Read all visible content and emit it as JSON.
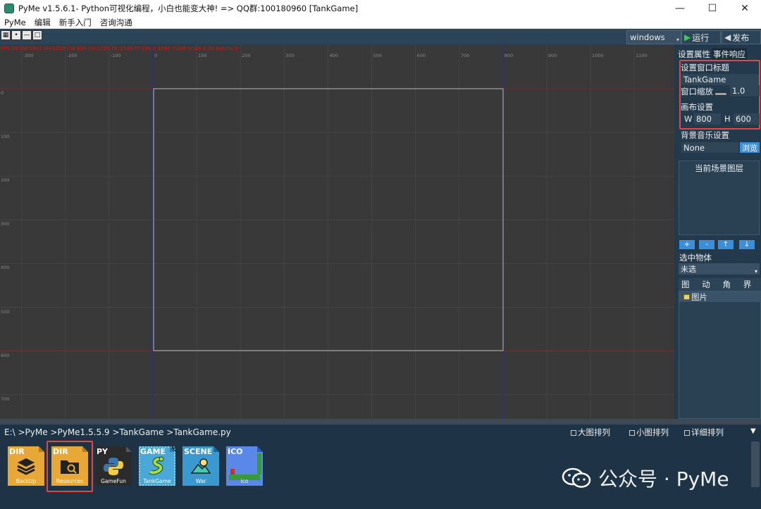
{
  "window": {
    "title": "PyMe v1.5.6.1- Python可视化编程，小白也能变大神!  => QQ群:100180960   [TankGame]",
    "minimize": "—",
    "maximize": "☐",
    "close": "✕"
  },
  "menu": [
    "PyMe",
    "编辑",
    "新手入门",
    "咨询沟通"
  ],
  "toolbar": {
    "icons": [
      "grid-icon",
      "dot-icon",
      "line-icon",
      "square-icon"
    ],
    "platform": "windows",
    "run_label": "运行",
    "publish_label": "发布"
  },
  "stage": {
    "fps_text": "FPS:59 SW:1912 SH:1209 CW:690 CH:1209 PX:1549 PY:339 X:1060 Y:206 Scale:1.10 Batchs:0",
    "ruler_x": [
      "-300",
      "-200",
      "-100",
      "0",
      "100",
      "200",
      "300",
      "400",
      "500",
      "600",
      "700",
      "800",
      "900",
      "1000",
      "1100"
    ],
    "ruler_y": [
      "0",
      "100",
      "200",
      "300",
      "400",
      "500",
      "600",
      "700"
    ]
  },
  "panel": {
    "tabs": [
      "设置属性",
      "事件响应"
    ],
    "title_label": "设置窗口标题",
    "title_value": "TankGame",
    "scale_label": "窗口缩放",
    "scale_value": "1.0",
    "canvas_label": "画布设置",
    "w_label": "W",
    "w_value": "800",
    "h_label": "H",
    "h_value": "600",
    "bgm_label": "背景音乐设置",
    "bgm_value": "None",
    "browse_label": "浏览",
    "layers_label": "当前场景图层",
    "layer_buttons": [
      "+",
      "-",
      "↑",
      "↓"
    ],
    "selected_label": "选中物体",
    "selected_value": "未选",
    "res_tabs": [
      "图片",
      "动画",
      "角色",
      "界面"
    ],
    "tree_item": "图片"
  },
  "bottom": {
    "path": "E:\\ >PyMe >PyMe1.5.5.9 >TankGame >TankGame.py",
    "view_large": "大图排列",
    "view_small": "小图排列",
    "view_detail": "详细排列",
    "collapse": "▼",
    "files": [
      {
        "type": "DIR",
        "name": "BackUp",
        "color": "#e8a838",
        "icon": "stack-icon"
      },
      {
        "type": "DIR",
        "name": "Resources",
        "color": "#e8a838",
        "icon": "folder-search-icon"
      },
      {
        "type": "PY",
        "name": "GameFun",
        "color": "#2b2b2b",
        "icon": "python-icon"
      },
      {
        "type": "GAME",
        "name": "TankGame",
        "color": "#4aa8d8",
        "icon": "snake-icon"
      },
      {
        "type": "SCENE",
        "name": "War",
        "color": "#3a9ad0",
        "icon": "landscape-icon"
      },
      {
        "type": "ICO",
        "name": "ico",
        "color": "#5a88e8",
        "icon": "pixel-image-icon"
      }
    ]
  },
  "watermark": "公众号 · PyMe"
}
